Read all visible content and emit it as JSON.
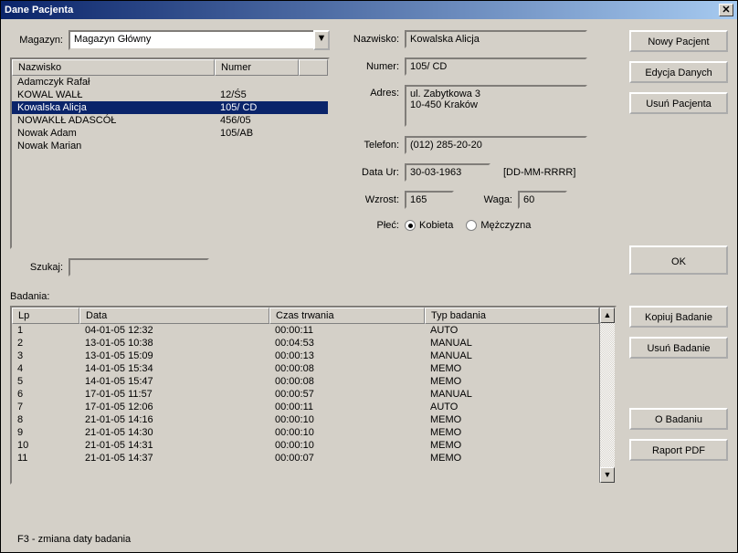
{
  "window": {
    "title": "Dane Pacjenta",
    "close_glyph": "✕"
  },
  "top": {
    "magazyn_label": "Magazyn:",
    "magazyn_value": "Magazyn Główny",
    "dd_arrow": "▼",
    "list_headers": {
      "nazwisko": "Nazwisko",
      "numer": "Numer"
    },
    "patients": [
      {
        "name": "Adamczyk Rafał",
        "num": ""
      },
      {
        "name": "KOWAL WALŁ",
        "num": "12/Ś5"
      },
      {
        "name": "Kowalska Alicja",
        "num": "105/ CD",
        "selected": true
      },
      {
        "name": "NOWAKLŁ ADASCÓŁ",
        "num": "456/05"
      },
      {
        "name": "Nowak Adam",
        "num": "105/AB"
      },
      {
        "name": "Nowak Marian",
        "num": ""
      }
    ],
    "szukaj_label": "Szukaj:"
  },
  "details": {
    "nazwisko_label": "Nazwisko:",
    "nazwisko": "Kowalska Alicja",
    "numer_label": "Numer:",
    "numer": "105/ CD",
    "adres_label": "Adres:",
    "adres_line1": "ul. Zabytkowa 3",
    "adres_line2": "10-450 Kraków",
    "telefon_label": "Telefon:",
    "telefon": "(012) 285-20-20",
    "dataur_label": "Data Ur:",
    "dataur": "30-03-1963",
    "dataur_fmt": "[DD-MM-RRRR]",
    "wzrost_label": "Wzrost:",
    "wzrost": "165",
    "waga_label": "Waga:",
    "waga": "60",
    "plec_label": "Płeć:",
    "plec_k": "Kobieta",
    "plec_m": "Mężczyzna"
  },
  "buttons": {
    "nowy": "Nowy Pacjent",
    "edycja": "Edycja Danych",
    "usun_p": "Usuń Pacjenta",
    "ok": "OK",
    "kopiuj": "Kopiuj Badanie",
    "usun_b": "Usuń Badanie",
    "obad": "O Badaniu",
    "raport": "Raport PDF"
  },
  "badania": {
    "label": "Badania:",
    "headers": {
      "lp": "Lp",
      "data": "Data",
      "czas": "Czas trwania",
      "typ": "Typ badania"
    },
    "rows": [
      {
        "lp": "1",
        "data": "04-01-05   12:32",
        "czas": "00:00:11",
        "typ": "AUTO"
      },
      {
        "lp": "2",
        "data": "13-01-05   10:38",
        "czas": "00:04:53",
        "typ": "MANUAL"
      },
      {
        "lp": "3",
        "data": "13-01-05   15:09",
        "czas": "00:00:13",
        "typ": "MANUAL"
      },
      {
        "lp": "4",
        "data": "14-01-05   15:34",
        "czas": "00:00:08",
        "typ": "MEMO"
      },
      {
        "lp": "5",
        "data": "14-01-05   15:47",
        "czas": "00:00:08",
        "typ": "MEMO"
      },
      {
        "lp": "6",
        "data": "17-01-05   11:57",
        "czas": "00:00:57",
        "typ": "MANUAL"
      },
      {
        "lp": "7",
        "data": "17-01-05   12:06",
        "czas": "00:00:11",
        "typ": "AUTO"
      },
      {
        "lp": "8",
        "data": "21-01-05   14:16",
        "czas": "00:00:10",
        "typ": "MEMO"
      },
      {
        "lp": "9",
        "data": "21-01-05   14:30",
        "czas": "00:00:10",
        "typ": "MEMO"
      },
      {
        "lp": "10",
        "data": "21-01-05   14:31",
        "czas": "00:00:10",
        "typ": "MEMO"
      },
      {
        "lp": "11",
        "data": "21-01-05   14:37",
        "czas": "00:00:07",
        "typ": "MEMO"
      }
    ],
    "arrow_up": "▲",
    "arrow_down": "▼"
  },
  "footer": {
    "hint": "F3 - zmiana daty badania"
  }
}
